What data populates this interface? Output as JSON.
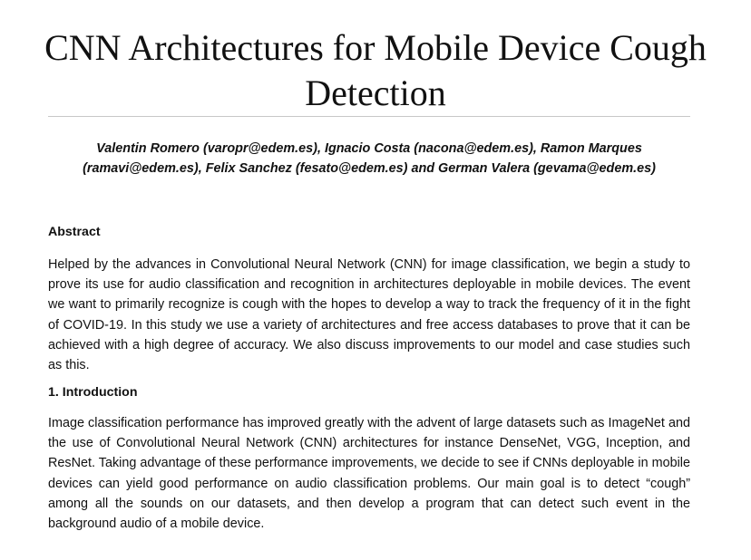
{
  "paper": {
    "title": "CNN Architectures for Mobile Device Cough Detection",
    "authors": "Valentin Romero (varopr@edem.es), Ignacio Costa (nacona@edem.es), Ramon Marques (ramavi@edem.es), Felix Sanchez (fesato@edem.es) and German Valera (gevama@edem.es)",
    "abstract": {
      "heading": "Abstract",
      "text": "Helped by the advances in Convolutional Neural Network (CNN) for image classification, we begin a study to prove its use for audio classification and recognition in architectures deployable in mobile devices. The event we want to primarily recognize is cough with the hopes to develop a way to track the frequency of it in the fight of COVID-19. In this study we use a variety of architectures and free access databases to prove that it can be achieved with a high degree of accuracy. We also discuss improvements to our model and case studies such as this."
    },
    "introduction": {
      "heading": "1. Introduction",
      "text": "Image classification performance has improved greatly with the advent of large datasets such as ImageNet and the use of Convolutional Neural Network (CNN) architectures for instance DenseNet, VGG, Inception, and ResNet. Taking advantage of these performance improvements, we decide to see if CNNs deployable in mobile devices can yield good performance on audio classification problems. Our main goal is to detect “cough” among all the sounds on our datasets, and then develop a program that can detect such event in the background audio of a mobile device."
    }
  }
}
